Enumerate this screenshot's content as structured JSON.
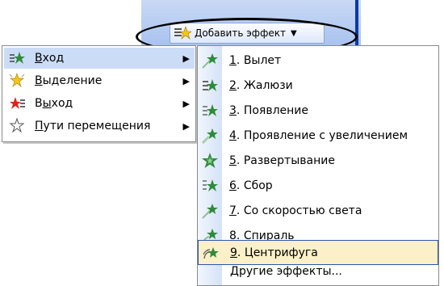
{
  "toolbar": {
    "add_effect_label": "Добавить эффект",
    "add_effect_icon": "add-effect-icon"
  },
  "menu_level1": [
    {
      "key": "В",
      "rest": "ход",
      "pre": "",
      "icon": "entrance-star-icon",
      "active": true,
      "label": "Вход"
    },
    {
      "key": "В",
      "rest": "ыделение",
      "pre": "",
      "icon": "emphasis-star-icon",
      "label": "Выделение"
    },
    {
      "key": "ы",
      "rest": "ход",
      "pre": "В",
      "icon": "exit-star-icon",
      "label": "Выход"
    },
    {
      "key": "П",
      "rest": "ути перемещения",
      "pre": "",
      "icon": "motion-path-icon",
      "label": "Пути перемещения"
    }
  ],
  "menu_level2": [
    {
      "num": "1",
      "rest": ". Вылет",
      "icon": "fly-in-icon"
    },
    {
      "num": "2",
      "rest": ". Жалюзи",
      "icon": "blinds-icon"
    },
    {
      "num": "3",
      "rest": ". Появление",
      "icon": "appear-icon"
    },
    {
      "num": "4",
      "rest": ". Проявление с увеличением",
      "icon": "fade-zoom-icon"
    },
    {
      "num": "5",
      "rest": ". Развертывание",
      "icon": "expand-icon"
    },
    {
      "num": "6",
      "rest": ". Сбор",
      "icon": "assemble-icon"
    },
    {
      "num": "7",
      "rest": ". Со скоростью света",
      "icon": "light-speed-icon"
    },
    {
      "num": "8",
      "rest": ". Спираль",
      "icon": "spiral-icon"
    },
    {
      "num": "9",
      "rest": ". Центрифуга",
      "icon": "centrifuge-icon",
      "selected": true
    }
  ],
  "more_effects_label": "Другие эффекты...",
  "colors": {
    "menu_highlight": "#cbdcf7",
    "selected_item_bg": "#fbf0c8",
    "selected_item_border": "#2b55b5",
    "star_green": "#2e8b3a",
    "star_red": "#d8261b",
    "star_yellow": "#f5c518"
  }
}
